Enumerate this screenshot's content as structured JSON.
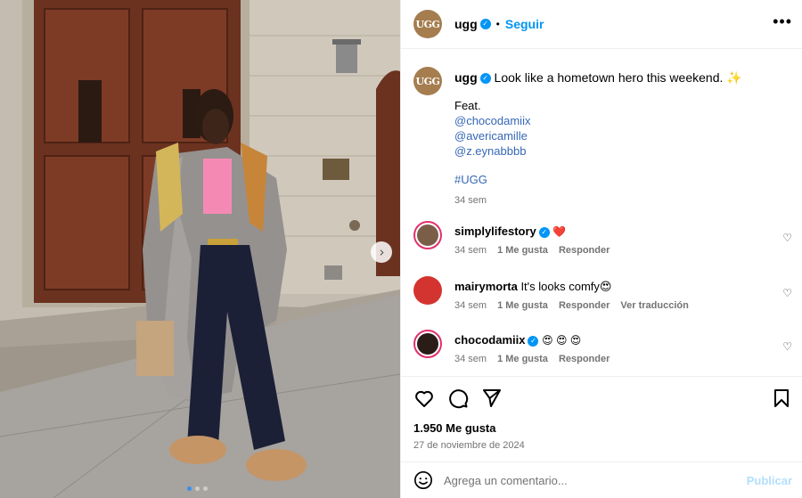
{
  "post": {
    "author": "ugg",
    "avatar_text": "UGG",
    "follow_label": "Seguir",
    "separator": "•",
    "more": "•••"
  },
  "caption": {
    "author": "ugg",
    "text": "Look like a hometown hero this weekend. ✨",
    "feat_label": "Feat.",
    "mentions": [
      "@chocodamiix",
      "@avericamille",
      "@z.eynabbbb"
    ],
    "hashtag": "#UGG",
    "time": "34 sem"
  },
  "comments": [
    {
      "user": "simplylifestory",
      "verified": true,
      "text": "❤️",
      "time": "34 sem",
      "likes": "1 Me gusta",
      "reply": "Responder",
      "translate": ""
    },
    {
      "user": "mairymorta",
      "verified": false,
      "text": "It's looks comfy😍",
      "time": "34 sem",
      "likes": "1 Me gusta",
      "reply": "Responder",
      "translate": "Ver traducción"
    },
    {
      "user": "chocodamiix",
      "verified": true,
      "text": "😍 😍 😍",
      "time": "34 sem",
      "likes": "1 Me gusta",
      "reply": "Responder",
      "translate": ""
    }
  ],
  "actions": {
    "likes_count": "1.950 Me gusta",
    "date": "27 de noviembre de 2024"
  },
  "add_comment": {
    "placeholder": "Agrega un comentario...",
    "publish_label": "Publicar"
  },
  "carousel": {
    "current": 1,
    "total": 3
  },
  "colors": {
    "accent": "#0095f6",
    "link": "#3567b5",
    "muted": "#737373",
    "publish_disabled": "#b2dffc"
  }
}
